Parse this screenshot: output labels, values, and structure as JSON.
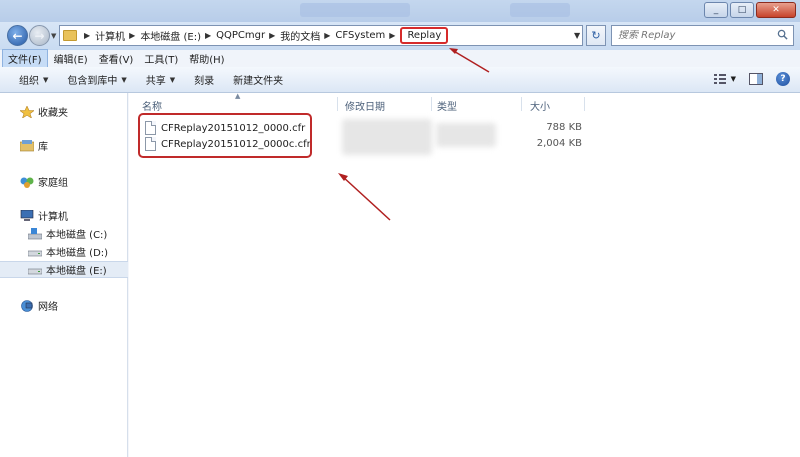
{
  "address": {
    "crumbs": [
      {
        "label": "计算机"
      },
      {
        "label": "本地磁盘 (E:)"
      },
      {
        "label": "QQPCmgr"
      },
      {
        "label": "我的文档"
      },
      {
        "label": "CFSystem"
      },
      {
        "label": "Replay"
      }
    ]
  },
  "search": {
    "placeholder": "搜索 Replay"
  },
  "menu": [
    "文件(F)",
    "编辑(E)",
    "查看(V)",
    "工具(T)",
    "帮助(H)"
  ],
  "toolbar": {
    "organize": "组织",
    "include_library": "包含到库中",
    "share": "共享",
    "burn": "刻录",
    "new_folder": "新建文件夹"
  },
  "nav": {
    "favorites": "收藏夹",
    "libraries": "库",
    "homegroup": "家庭组",
    "computer": "计算机",
    "drive_c": "本地磁盘 (C:)",
    "drive_d": "本地磁盘 (D:)",
    "drive_e": "本地磁盘 (E:)",
    "network": "网络"
  },
  "columns": {
    "name": "名称",
    "modified": "修改日期",
    "type": "类型",
    "size": "大小"
  },
  "files": [
    {
      "name": "CFReplay20151012_0000.cfr",
      "size": "788 KB"
    },
    {
      "name": "CFReplay20151012_0000c.cfr",
      "size": "2,004 KB"
    }
  ],
  "colors": {
    "highlight": "#c02a2a",
    "address_bg": "#c9dbf1"
  }
}
